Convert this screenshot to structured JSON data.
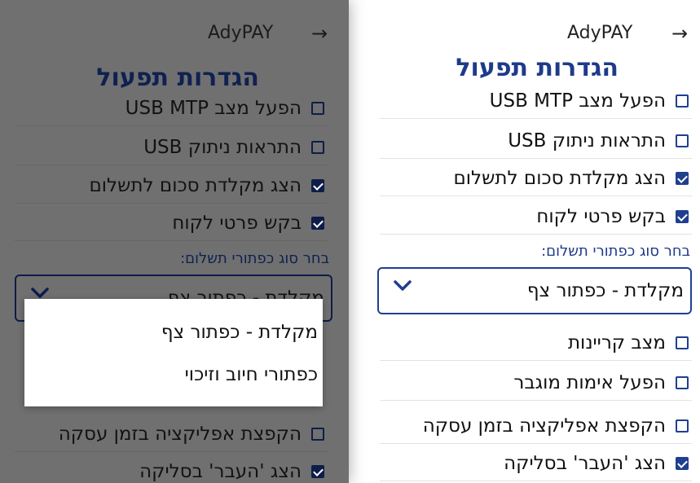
{
  "app_title": "AdyPAY",
  "page_title": "הגדרות תפעול",
  "settings_before": [
    {
      "label": "הפעל מצב USB MTP",
      "checked": false
    },
    {
      "label": "התראות ניתוק USB",
      "checked": false
    },
    {
      "label": "הצג מקלדת סכום לתשלום",
      "checked": true
    },
    {
      "label": "בקש פרטי לקוח",
      "checked": true
    }
  ],
  "payment_buttons_label": "בחר סוג כפתורי תשלום:",
  "payment_buttons_selected": "מקלדת - כפתור צף",
  "settings_after": [
    {
      "label": "מצב קריינות",
      "checked": false
    },
    {
      "label": "הפעל אימות מוגבר",
      "checked": false
    },
    {
      "label": "הקפצת אפליקציה בזמן עסקה",
      "checked": false
    },
    {
      "label": "הצג 'העבר' בסליקה",
      "checked": true
    }
  ],
  "dropdown_options": [
    "מקלדת - כפתור צף",
    "כפתורי חיוב וזיכוי"
  ],
  "colors": {
    "primary": "#1f3f8f",
    "title": "#1e3a8a",
    "overlay": "#707070"
  }
}
